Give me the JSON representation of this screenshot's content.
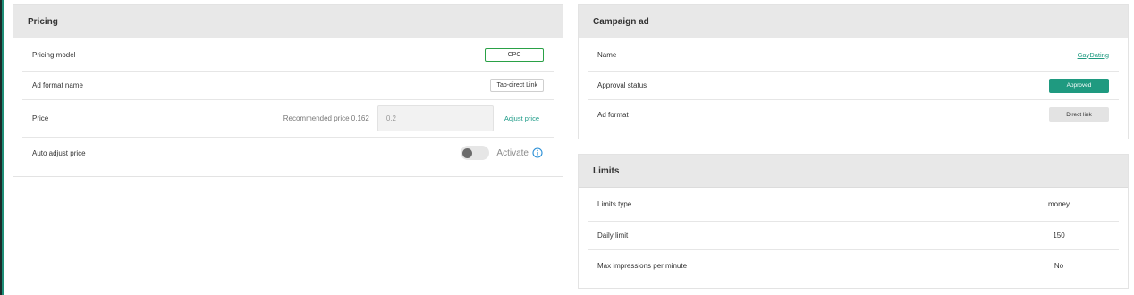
{
  "pricing": {
    "title": "Pricing",
    "pricing_model_label": "Pricing model",
    "pricing_model_value": "CPC",
    "ad_format_name_label": "Ad format name",
    "ad_format_name_value": "Tab-direct Link",
    "price_label": "Price",
    "recommended_price_text": "Recommended price 0.162",
    "price_value": "0.2",
    "adjust_price_link": "Adjust price",
    "auto_adjust_label": "Auto adjust price",
    "auto_adjust_enabled": false,
    "activate_label": "Activate"
  },
  "campaign_ad": {
    "title": "Campaign ad",
    "name_label": "Name",
    "name_value": "GayDating",
    "approval_status_label": "Approval status",
    "approval_status_value": "Approved",
    "ad_format_label": "Ad format",
    "ad_format_value": "Direct link"
  },
  "limits": {
    "title": "Limits",
    "rows": [
      {
        "label": "Limits type",
        "value": "money"
      },
      {
        "label": "Daily limit",
        "value": "150"
      },
      {
        "label": "Max impressions per minute",
        "value": "No"
      }
    ]
  },
  "colors": {
    "accent": "#1f9a80",
    "cpc_border": "#2aa146",
    "header_bg": "#e8e8e8"
  }
}
